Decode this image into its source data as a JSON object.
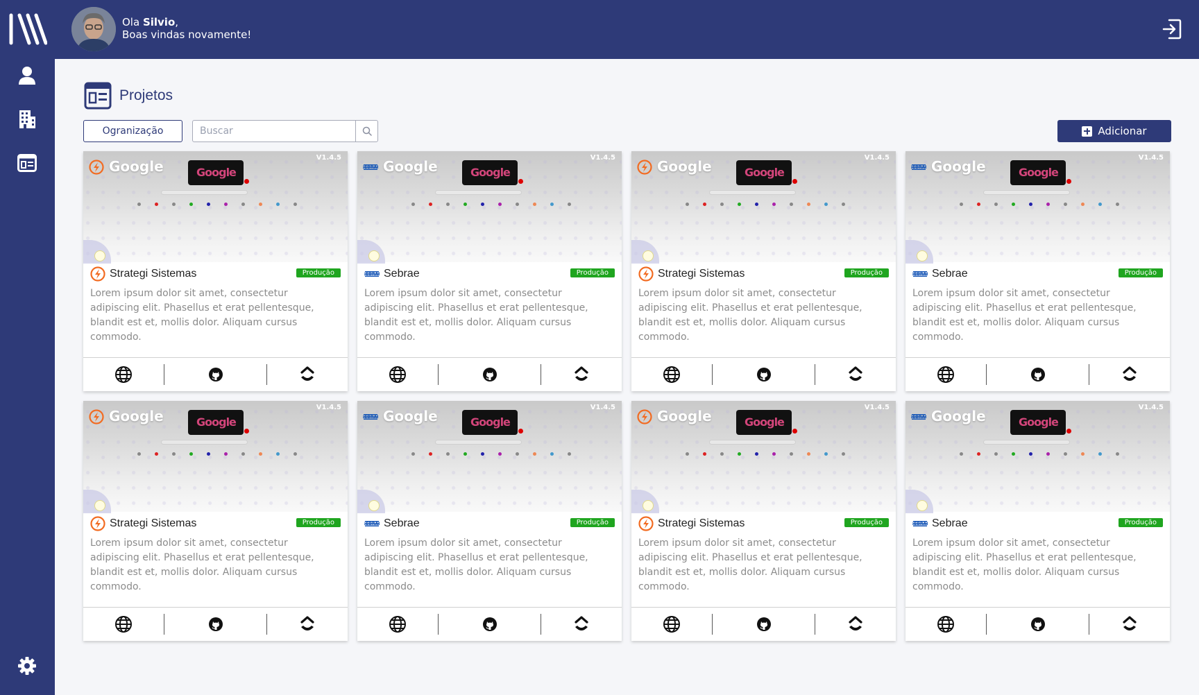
{
  "header": {
    "greeting_prefix": "Ola ",
    "user_name": "Silvio",
    "greeting_comma": ",",
    "welcome": "Boas vindas novamente!"
  },
  "page": {
    "title": "Projetos"
  },
  "toolbar": {
    "organization_label": "Ogranização",
    "search_placeholder": "Buscar",
    "add_label": "Adicionar"
  },
  "colors": {
    "primary": "#2e3a78",
    "badge_green": "#1fa51f",
    "strategi_orange": "#f26b21",
    "sebrae_blue": "#1e5bb8"
  },
  "projects": [
    {
      "preview_title": "Google",
      "version": "V1.4.5",
      "org": "Strategi Sistemas",
      "org_logo": "strategi-logo",
      "status": "Produção",
      "description": "Lorem ipsum dolor sit amet, consectetur adipiscing elit. Phasellus et erat pellentesque, blandit est et, mollis dolor. Aliquam cursus commodo."
    },
    {
      "preview_title": "Google",
      "version": "V1.4.5",
      "org": "Sebrae",
      "org_logo": "sebrae-logo",
      "status": "Produção",
      "description": "Lorem ipsum dolor sit amet, consectetur adipiscing elit. Phasellus et erat pellentesque, blandit est et, mollis dolor. Aliquam cursus commodo."
    },
    {
      "preview_title": "Google",
      "version": "V1.4.5",
      "org": "Strategi Sistemas",
      "org_logo": "strategi-logo",
      "status": "Produção",
      "description": "Lorem ipsum dolor sit amet, consectetur adipiscing elit. Phasellus et erat pellentesque, blandit est et, mollis dolor. Aliquam cursus commodo."
    },
    {
      "preview_title": "Google",
      "version": "V1.4.5",
      "org": "Sebrae",
      "org_logo": "sebrae-logo",
      "status": "Produção",
      "description": "Lorem ipsum dolor sit amet, consectetur adipiscing elit. Phasellus et erat pellentesque, blandit est et, mollis dolor. Aliquam cursus commodo."
    },
    {
      "preview_title": "Google",
      "version": "V1.4.5",
      "org": "Strategi Sistemas",
      "org_logo": "strategi-logo",
      "status": "Produção",
      "description": "Lorem ipsum dolor sit amet, consectetur adipiscing elit. Phasellus et erat pellentesque, blandit est et, mollis dolor. Aliquam cursus commodo."
    },
    {
      "preview_title": "Google",
      "version": "V1.4.5",
      "org": "Sebrae",
      "org_logo": "sebrae-logo",
      "status": "Produção",
      "description": "Lorem ipsum dolor sit amet, consectetur adipiscing elit. Phasellus et erat pellentesque, blandit est et, mollis dolor. Aliquam cursus commodo."
    },
    {
      "preview_title": "Google",
      "version": "V1.4.5",
      "org": "Strategi Sistemas",
      "org_logo": "strategi-logo",
      "status": "Produção",
      "description": "Lorem ipsum dolor sit amet, consectetur adipiscing elit. Phasellus et erat pellentesque, blandit est et, mollis dolor. Aliquam cursus commodo."
    },
    {
      "preview_title": "Google",
      "version": "V1.4.5",
      "org": "Sebrae",
      "org_logo": "sebrae-logo",
      "status": "Produção",
      "description": "Lorem ipsum dolor sit amet, consectetur adipiscing elit. Phasellus et erat pellentesque, blandit est et, mollis dolor. Aliquam cursus commodo."
    }
  ],
  "sidebar": {
    "items": [
      {
        "icon": "user-icon"
      },
      {
        "icon": "building-icon"
      },
      {
        "icon": "projects-icon"
      }
    ],
    "bottom_icon": "gear-icon"
  }
}
